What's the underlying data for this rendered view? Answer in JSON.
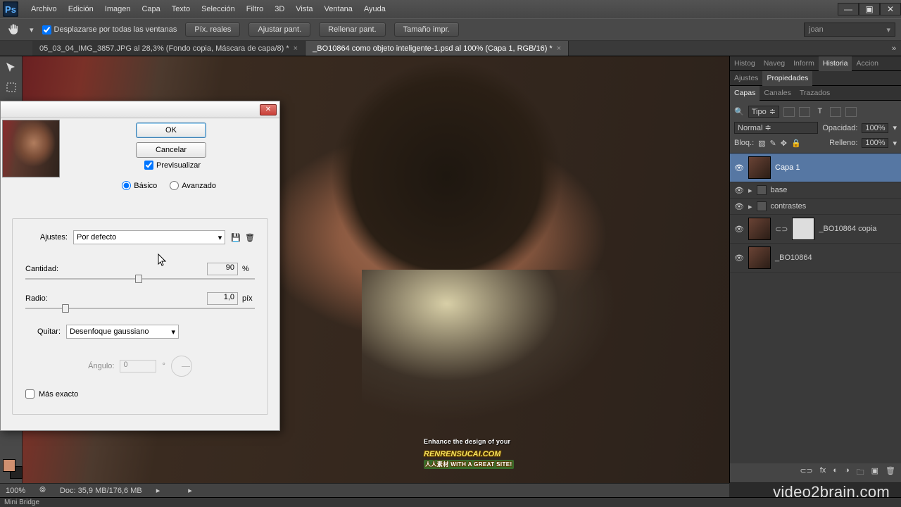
{
  "app": {
    "logo": "Ps"
  },
  "menu": [
    "Archivo",
    "Edición",
    "Imagen",
    "Capa",
    "Texto",
    "Selección",
    "Filtro",
    "3D",
    "Vista",
    "Ventana",
    "Ayuda"
  ],
  "options": {
    "scroll_all": "Desplazarse por todas las ventanas",
    "buttons": [
      "Píx. reales",
      "Ajustar pant.",
      "Rellenar pant.",
      "Tamaño impr."
    ],
    "user": "joan"
  },
  "tabs": [
    {
      "label": "05_03_04_IMG_3857.JPG al 28,3% (Fondo copia, Máscara de capa/8) *",
      "active": false
    },
    {
      "label": "_BO10864 como objeto inteligente-1.psd al 100% (Capa 1, RGB/16) *",
      "active": true
    }
  ],
  "right": {
    "row1": [
      "Histog",
      "Naveg",
      "Inform",
      "Historia",
      "Accion"
    ],
    "row1_active": "Historia",
    "row2": [
      "Ajustes",
      "Propiedades"
    ],
    "row2_active": "Propiedades",
    "row3": [
      "Capas",
      "Canales",
      "Trazados"
    ],
    "row3_active": "Capas",
    "kind_label": "Tipo",
    "mode": "Normal",
    "opacity_label": "Opacidad:",
    "opacity_value": "100%",
    "lock_label": "Bloq.:",
    "fill_label": "Relleno:",
    "fill_value": "100%",
    "layers": [
      {
        "name": "Capa 1",
        "type": "layer",
        "selected": true
      },
      {
        "name": "base",
        "type": "group"
      },
      {
        "name": "contrastes",
        "type": "group"
      },
      {
        "name": "_BO10864 copia",
        "type": "smart-mask"
      },
      {
        "name": "_BO10864",
        "type": "layer"
      }
    ]
  },
  "status": {
    "zoom": "100%",
    "doc": "Doc: 35,9 MB/176,6 MB",
    "minibridge": "Mini Bridge"
  },
  "dialog": {
    "ok": "OK",
    "cancel": "Cancelar",
    "preview": "Previsualizar",
    "basic": "Básico",
    "advanced": "Avanzado",
    "presets_label": "Ajustes:",
    "preset_value": "Por defecto",
    "amount_label": "Cantidad:",
    "amount_value": "90",
    "amount_unit": "%",
    "radius_label": "Radio:",
    "radius_value": "1,0",
    "radius_unit": "píx",
    "remove_label": "Quitar:",
    "remove_value": "Desenfoque gaussiano",
    "angle_label": "Ángulo:",
    "angle_value": "0",
    "angle_unit": "°",
    "more_accurate": "Más exacto"
  },
  "watermarks": {
    "rr_top": "Enhance the design of your",
    "rr_main": "RENRENSUCAI.COM",
    "rr_sub": "人人素材    WITH A GREAT SITE!",
    "v2b": "video2brain.com"
  }
}
